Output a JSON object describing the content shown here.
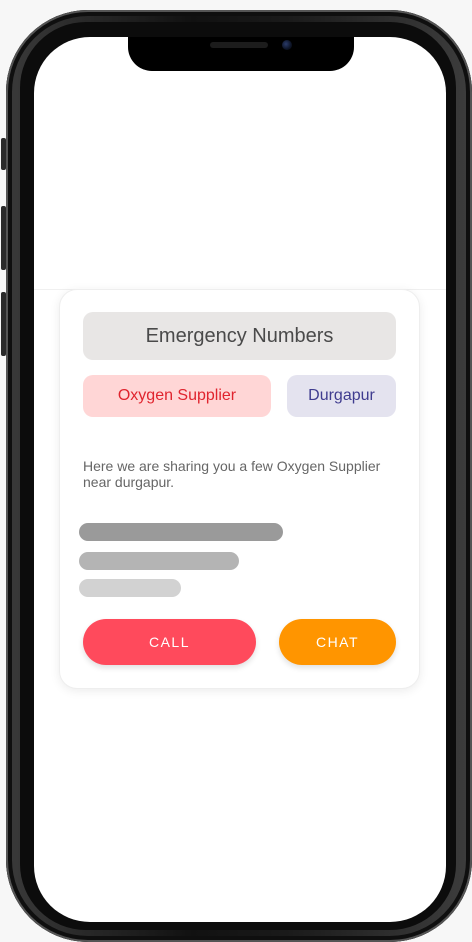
{
  "card": {
    "title": "Emergency Numbers",
    "category_chip": "Oxygen Supplier",
    "location_chip": "Durgapur",
    "description": "Here we are sharing you a few Oxygen Supplier near durgapur."
  },
  "actions": {
    "call_label": "CALL",
    "chat_label": "CHAT"
  },
  "colors": {
    "call_button": "#ff4a5c",
    "chat_button": "#ff9500",
    "category_chip_bg": "#ffd6d6",
    "category_chip_text": "#e0242e",
    "location_chip_bg": "#e4e3ef",
    "location_chip_text": "#3f3c8f",
    "title_bg": "#e8e6e5"
  }
}
